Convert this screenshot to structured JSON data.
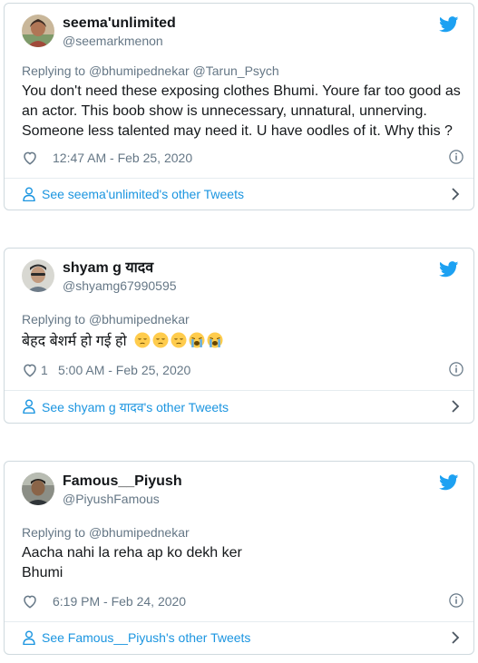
{
  "tweets": [
    {
      "display_name": "seema'unlimited",
      "handle": "@seemarkmenon",
      "replying_prefix": "Replying to",
      "replying_to": "@bhumipednekar @Tarun_Psych",
      "text": "You don't need these exposing clothes Bhumi. Youre far too good as an actor. This boob show is unnecessary, unnatural, unnerving. Someone less talented may need it. U have oodles of it. Why this ?",
      "likes": "",
      "timestamp": "12:47 AM - Feb 25, 2020",
      "footer_link": "See seema'unlimited's other Tweets"
    },
    {
      "display_name": "shyam g यादव",
      "handle": "@shyamg67990595",
      "replying_prefix": "Replying to",
      "replying_to": "@bhumipednekar",
      "text": "बेहद बेशर्म हो गई हो",
      "emojis": [
        "pensive-face",
        "pensive-face",
        "pensive-face",
        "loudly-crying-face",
        "loudly-crying-face"
      ],
      "likes": "1",
      "timestamp": "5:00 AM - Feb 25, 2020",
      "footer_link": "See shyam g यादव's other Tweets"
    },
    {
      "display_name": "Famous__Piyush",
      "handle": "@PiyushFamous",
      "replying_prefix": "Replying to",
      "replying_to": "@bhumipednekar",
      "text_line1": "Aacha nahi la reha ap ko dekh ker",
      "text_line2": "Bhumi",
      "likes": "",
      "timestamp": "6:19 PM - Feb 24, 2020",
      "footer_link": "See Famous__Piyush's other Tweets"
    }
  ],
  "colors": {
    "twitter_blue": "#1da1f2",
    "link_blue": "#1b95e0",
    "secondary_text": "#657786",
    "border": "#cfd9de"
  }
}
